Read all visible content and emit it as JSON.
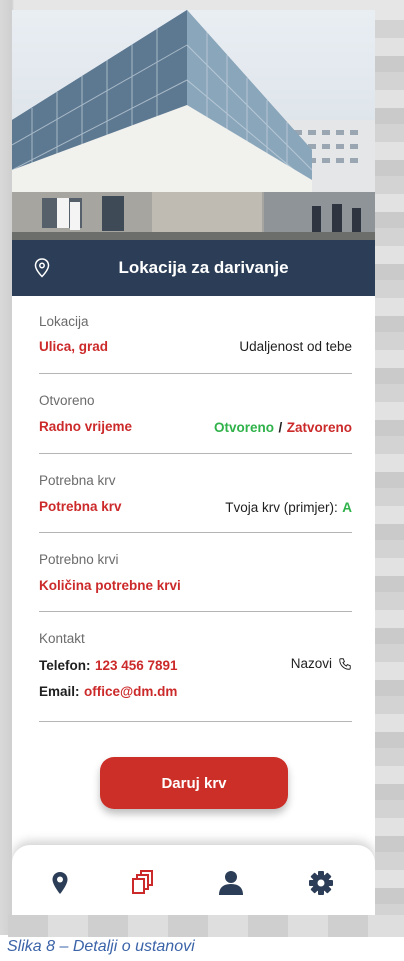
{
  "header": {
    "title": "Lokacija za darivanje",
    "pin_icon": "location-pin-icon"
  },
  "details": {
    "location": {
      "label": "Lokacija",
      "value": "Ulica, grad",
      "distance": "Udaljenost od tebe"
    },
    "open": {
      "label": "Otvoreno",
      "value": "Radno vrijeme",
      "status_open": "Otvoreno",
      "separator": "/",
      "status_closed": "Zatvoreno"
    },
    "needed_blood": {
      "label": "Potrebna krv",
      "value": "Potrebna krv",
      "your_blood_label": "Tvoja krv (primjer):",
      "your_blood_value": "A"
    },
    "blood_amount": {
      "label": "Potrebno krvi",
      "value": "Količina potrebne krvi"
    },
    "contact": {
      "label": "Kontakt",
      "phone_label": "Telefon:",
      "phone_value": "123 456 7891",
      "call_label": "Nazovi",
      "call_icon": "phone-icon",
      "email_label": "Email:",
      "email_value": "office@dm.dm"
    }
  },
  "donate_button": "Daruj krv",
  "nav": [
    {
      "name": "location-pin-icon"
    },
    {
      "name": "copy-icon"
    },
    {
      "name": "user-icon"
    },
    {
      "name": "gear-icon"
    }
  ],
  "caption": "Slika 8 –  Detalji o ustanovi",
  "colors": {
    "accent_red": "#cc2a2a",
    "header_navy": "#2c3e57",
    "open_green": "#2fb24a"
  }
}
